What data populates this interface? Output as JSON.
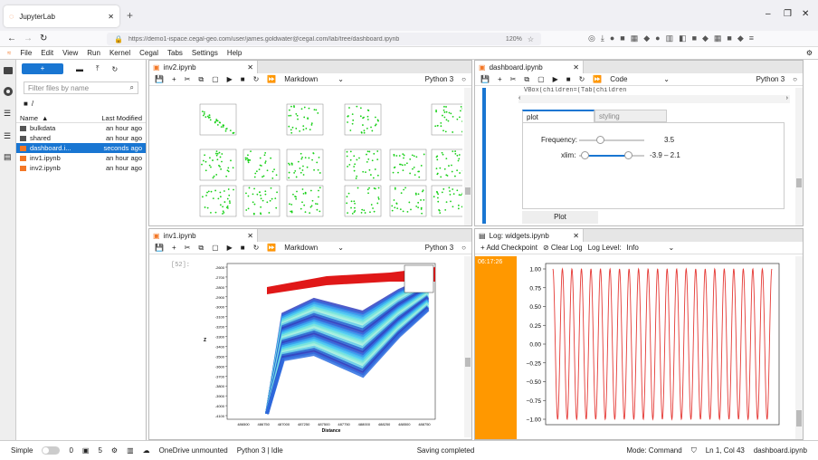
{
  "browser": {
    "tab_title": "JupyterLab",
    "url": "https://demo1-ispace.cegal-geo.com/user/james.goldwater@cegal.com/lab/tree/dashboard.ipynb",
    "zoom": "120%"
  },
  "menu": [
    "File",
    "Edit",
    "View",
    "Run",
    "Kernel",
    "Cegal",
    "Tabs",
    "Settings",
    "Help"
  ],
  "filebrowser": {
    "filter_placeholder": "Filter files by name",
    "path": "/",
    "col_name": "Name",
    "col_modified": "Last Modified",
    "files": [
      {
        "name": "bulkdata",
        "modified": "an hour ago",
        "type": "folder"
      },
      {
        "name": "shared",
        "modified": "an hour ago",
        "type": "folder"
      },
      {
        "name": "dashboard.i...",
        "modified": "seconds ago",
        "type": "notebook",
        "selected": true
      },
      {
        "name": "inv1.ipynb",
        "modified": "an hour ago",
        "type": "notebook"
      },
      {
        "name": "inv2.ipynb",
        "modified": "an hour ago",
        "type": "notebook"
      }
    ]
  },
  "panels": {
    "inv2": {
      "tab": "inv2.ipynb",
      "celltype": "Markdown",
      "kernel": "Python 3"
    },
    "dashboard": {
      "tab": "dashboard.ipynb",
      "celltype": "Code",
      "kernel": "Python 3",
      "code_line": "VBox(children=(Tab(children",
      "tabs": [
        "plot",
        "styling"
      ],
      "freq_label": "Frequency:",
      "freq_value": "3.5",
      "freq_level": 0.3,
      "xlim_label": "xlim:",
      "xlim_value": "-3.9 – 2.1",
      "button": "Plot"
    },
    "inv1": {
      "tab": "inv1.ipynb",
      "celltype": "Markdown",
      "kernel": "Python 3",
      "prompt": "[52]:",
      "xlabel": "Distance",
      "ylabel": "Z",
      "yticks": [
        "-2600",
        "-2700",
        "-2800",
        "-2900",
        "-3000",
        "-3100",
        "-3200",
        "-3300",
        "-3400",
        "-3500",
        "-3600",
        "-3700",
        "-3800",
        "-3900",
        "-4000",
        "-4100"
      ],
      "xticks": [
        "486500",
        "486750",
        "487000",
        "487250",
        "487500",
        "487750",
        "488000",
        "488250",
        "488500",
        "488750"
      ]
    },
    "log": {
      "tab": "Log: widgets.ipynb",
      "add": "Add Checkpoint",
      "clear": "Clear Log",
      "level_label": "Log Level:",
      "level": "Info",
      "timestamp": "06:17:26",
      "yticks": [
        "1.00",
        "0.75",
        "0.50",
        "0.25",
        "0.00",
        "−0.25",
        "−0.50",
        "−0.75",
        "−1.00"
      ]
    }
  },
  "status": {
    "mode": "Simple",
    "n1": "0",
    "n2": "5",
    "onedrive": "OneDrive unmounted",
    "kernel": "Python 3 | Idle",
    "saving": "Saving completed",
    "cmd": "Mode: Command",
    "pos": "Ln 1, Col 43",
    "file": "dashboard.ipynb"
  },
  "chart_data": {
    "type": "line",
    "title": "",
    "ylim": [
      -1,
      1
    ],
    "yticks": [
      1.0,
      0.75,
      0.5,
      0.25,
      0.0,
      -0.25,
      -0.5,
      -0.75,
      -1.0
    ],
    "series": [
      {
        "values_description_free": true,
        "frequency_cycles": 23,
        "amplitude": 1
      }
    ]
  }
}
